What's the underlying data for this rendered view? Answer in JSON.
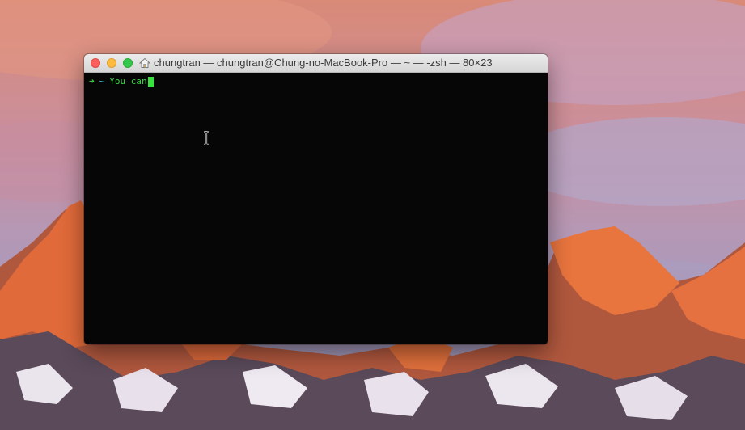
{
  "window": {
    "title": "chungtran — chungtran@Chung-no-MacBook-Pro — ~ — -zsh — 80×23",
    "icon": "home-icon"
  },
  "terminal": {
    "prompt_arrow": "➜",
    "prompt_dir": "~",
    "typed_text": "You can"
  },
  "colors": {
    "prompt_green": "#3ad24a",
    "dir_cyan": "#3fc6c6",
    "cursor_green": "#37e23f",
    "terminal_bg": "#060606"
  }
}
